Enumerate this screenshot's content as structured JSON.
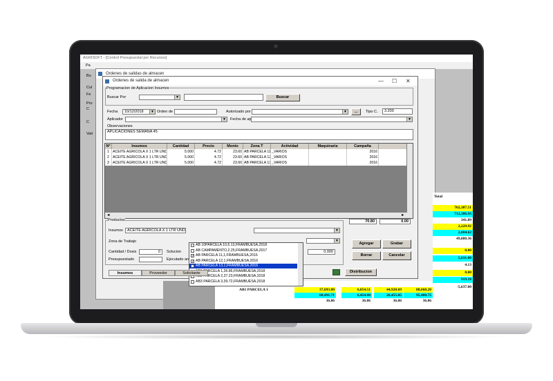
{
  "app": {
    "title": "AGRISOFT - [Control Presupuestal por Recursos]",
    "menu_fragment": "Pa",
    "left_labels": [
      "Bu",
      "Cul",
      "Fe",
      "Pro",
      "C",
      "C",
      "Vari"
    ],
    "back_window_title": "Ordenes de salidas de almacen",
    "total_header": "Total",
    "side_values": [
      {
        "v": "762,387.51",
        "bg": "#ffff00"
      },
      {
        "v": "712,306.93",
        "bg": "#00ffff"
      },
      {
        "v": "341.89",
        "bg": "#ffffff"
      },
      {
        "v": "2,229.92",
        "bg": "#ffff00"
      },
      {
        "v": "2,084.62",
        "bg": "#00ffff"
      },
      {
        "v": "49,880.36",
        "bg": "#ffffff"
      }
    ],
    "side_values2": [
      {
        "v": "0.00",
        "bg": "#ffff00"
      },
      {
        "v": "5,631.00",
        "bg": "#00ffff"
      },
      {
        "v": "4.13",
        "bg": "#ffffff"
      },
      {
        "v": "0.00",
        "bg": "#ffff00"
      },
      {
        "v": "919.18",
        "bg": "#00ffff"
      },
      {
        "v": "-5,637.00",
        "bg": "#ffffff"
      }
    ],
    "bottom_row_label": "AB1 PARCELA 1",
    "bottom_rows": [
      [
        {
          "v": "37,693.80",
          "bg": "#ffff00"
        },
        {
          "v": "6,054.51",
          "bg": "#ffff00"
        },
        {
          "v": "44,920.69",
          "bg": "#ffff00"
        },
        {
          "v": "88,668.20",
          "bg": "#ffff00"
        }
      ],
      [
        {
          "v": "60,491.71",
          "bg": "#00ffff"
        },
        {
          "v": "6,454.00",
          "bg": "#00ffff"
        },
        {
          "v": "26,455.05",
          "bg": "#00ffff"
        },
        {
          "v": "95,400.75",
          "bg": "#00ffff"
        }
      ],
      [
        {
          "v": "36.86",
          "bg": "#ffffff"
        },
        {
          "v": "36.86",
          "bg": "#ffffff"
        },
        {
          "v": "36.86",
          "bg": "#ffffff"
        },
        {
          "v": "36.86",
          "bg": "#ffffff"
        }
      ]
    ]
  },
  "dialog": {
    "title": "Ordenes de salida de almacen",
    "minimize": "—",
    "maximize": "☐",
    "close": "✕",
    "group_programacion": "Programacion de Aplicacion Insumos",
    "buscar_por_label": "Buscar Por",
    "buscar_por_value": "",
    "buscar_text": "",
    "buscar_button": "Buscar",
    "fecha_label": "Fecha",
    "fecha_value": "10/12/2018",
    "orden_label": "Orden de",
    "orden_value": "",
    "autorizado_label": "Autorizado por",
    "autorizado_value": "",
    "ellipsis": "...",
    "tipo_c_label": "Tipo C.",
    "tipo_c_value": "3.200",
    "aplicador_label": "Aplicador",
    "aplicador_value": "",
    "fecha_aplic_label": "Fecha de aplic",
    "observaciones_label": "Observaciones",
    "observaciones_value": "APLICACIONES SEMANA 45",
    "grid": {
      "headers": [
        "Nº",
        "Insumos",
        "Cantidad",
        "Precio",
        "Monto",
        "Zona T",
        "Actividad",
        "Maquinaria",
        "Campaña"
      ],
      "rows": [
        [
          "1",
          "ACEITE AGRICOLA X 1 LTR UND",
          "5.000",
          "4.72",
          "23.60",
          "AB PARCELA 11",
          "_VARIOS",
          "",
          "2016"
        ],
        [
          "2",
          "ACEITE AGRICOLA X 1 LTR UND",
          "5.000",
          "4.72",
          "23.60",
          "AB PARCELA 12",
          "_VARIOS",
          "",
          "2016"
        ],
        [
          "3",
          "ACEITE AGRICOLA X 1 LTR UND",
          "5.000",
          "4.72",
          "23.60",
          "AB PARCELA 13",
          "_VARIOS",
          "",
          "2016"
        ]
      ]
    },
    "totals": [
      "70.80",
      "0.00"
    ],
    "group_productos": "Productos",
    "insumos_label": "Insumos",
    "insumos_value": "ACEITE AGRICOLA X 1 LTR UND",
    "zona_label": "Zona de Trabajo",
    "cantidad_label": "Cantidad / Dosis",
    "cantidad_value": "0",
    "solucion_label": "Solucion",
    "solucion_value": "0.000",
    "presupuestado_label": "Presupuestado",
    "ejecutado_label": "Ejecutado an",
    "zona_list": [
      {
        "label": "AB 10PARCELA 10,6.13,FRAMBUESA,2018",
        "checked": false,
        "selected": false
      },
      {
        "label": "AB CAMPAMENTO,2.25,FRAMBUESA,2017",
        "checked": false,
        "selected": false
      },
      {
        "label": "AB PARCELA 11,1,FRAMBUESA,2016",
        "checked": true,
        "selected": false
      },
      {
        "label": "AB PARCELA 12,1,FRAMBUESA,2016",
        "checked": true,
        "selected": false
      },
      {
        "label": "AB PARCELA 13,1,FRAMBUESA,2016",
        "checked": true,
        "selected": true
      },
      {
        "label": "AB1 PARCELA 1,36.86,FRAMBUESA,2018",
        "checked": false,
        "selected": false
      },
      {
        "label": "AB2 PARCELA 2,37.23,FRAMBUESA,2018",
        "checked": false,
        "selected": false
      },
      {
        "label": "AB3 PARCELA 3,39.72,FRAMBUESA,2018",
        "checked": false,
        "selected": false
      }
    ],
    "buttons": {
      "agregar": "Agregar",
      "grabar": "Grabar",
      "borrar": "Borrar",
      "cancelar": "Cancelar",
      "distribucion": "Distribucion"
    },
    "tabs": [
      "Insumos",
      "Proveedor",
      "Solicitante"
    ]
  }
}
